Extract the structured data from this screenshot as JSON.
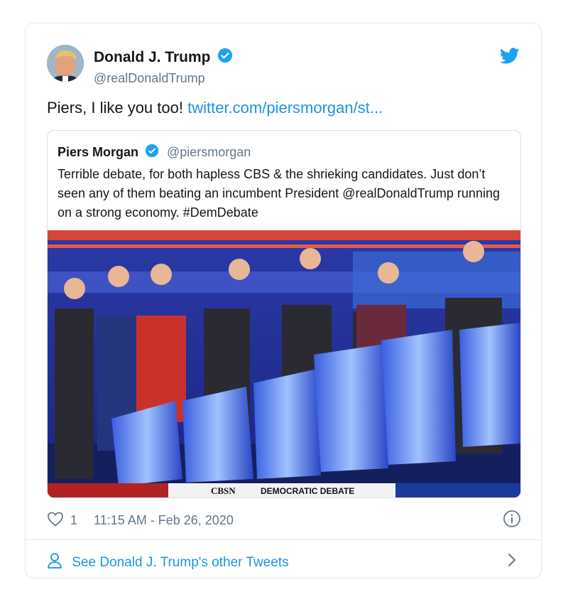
{
  "author": {
    "display_name": "Donald J. Trump",
    "handle": "@realDonaldTrump",
    "verified": true
  },
  "tweet": {
    "text": "Piers, I like you too! ",
    "link": "twitter.com/piersmorgan/st..."
  },
  "quoted_tweet": {
    "display_name": "Piers Morgan",
    "handle": "@piersmorgan",
    "verified": true,
    "text": "Terrible debate, for both hapless CBS & the shrieking candidates. Just don’t seen any of them beating an incumbent President @realDonaldTrump running on a strong economy. #DemDebate",
    "image": {
      "banner_text": "DEMOCRATIC DEBATE",
      "network_text": "CBSN",
      "description_icon": "debate-stage-photo"
    }
  },
  "footer": {
    "likes": "1",
    "timestamp": "11:15 AM - Feb 26, 2020"
  },
  "more_link": {
    "label": "See Donald J. Trump's other Tweets"
  },
  "colors": {
    "twitter_blue": "#1da1f2",
    "link_blue": "#1b95e0",
    "secondary_text": "#657786"
  }
}
